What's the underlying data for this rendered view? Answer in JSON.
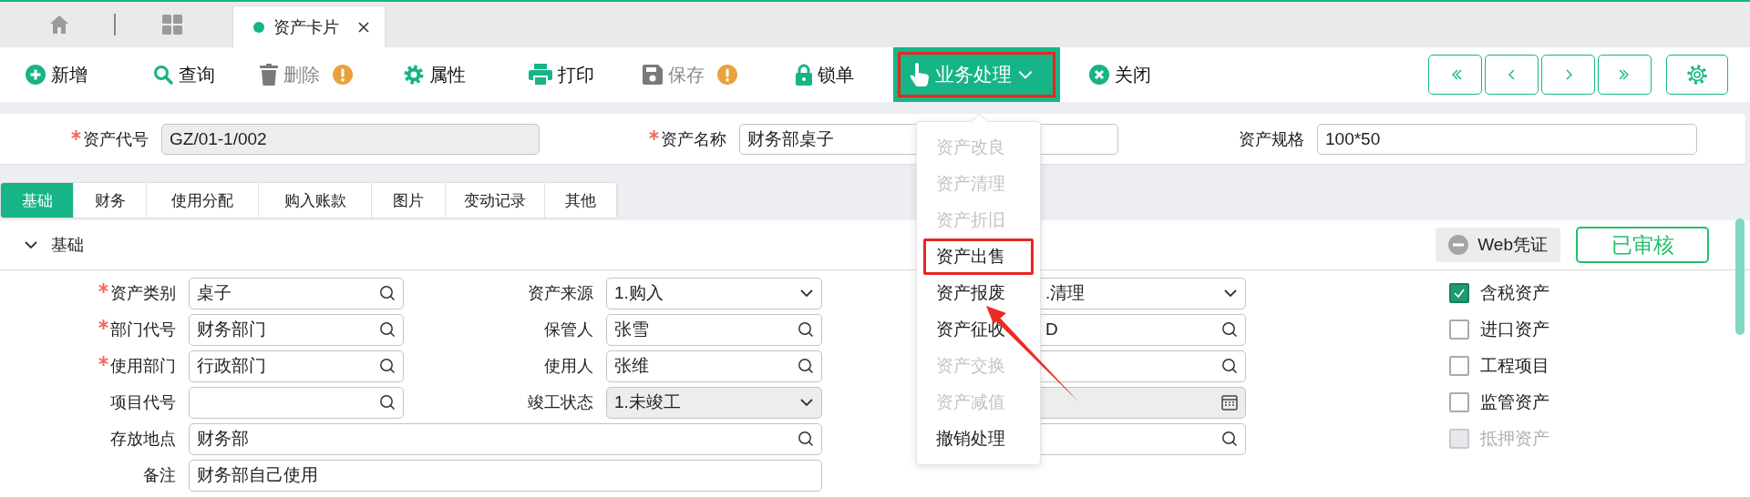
{
  "top_tabs": [
    {
      "label": "资产卡片",
      "selected": true
    }
  ],
  "toolbar": {
    "buttons": [
      {
        "label": "新增",
        "kind": "plain",
        "disabled": false,
        "warning": false
      },
      {
        "label": "查询",
        "kind": "plain",
        "disabled": false,
        "warning": false
      },
      {
        "label": "删除",
        "kind": "plain",
        "disabled": true,
        "warning": true
      },
      {
        "label": "属性",
        "kind": "plain",
        "disabled": false,
        "warning": false
      },
      {
        "label": "打印",
        "kind": "plain",
        "disabled": false,
        "warning": false
      },
      {
        "label": "保存",
        "kind": "plain",
        "disabled": true,
        "warning": true
      },
      {
        "label": "锁单",
        "kind": "plain",
        "disabled": false,
        "warning": false
      },
      {
        "label": "业务处理",
        "kind": "menu",
        "highlighted": true,
        "expanded": true
      },
      {
        "label": "关闭",
        "kind": "plain",
        "disabled": false,
        "warning": false
      }
    ]
  },
  "header_fields": [
    {
      "label": "资产代号",
      "required": true,
      "value": "GZ/01-1/002",
      "readonly": true
    },
    {
      "label": "资产名称",
      "required": true,
      "value": "财务部桌子",
      "readonly": false
    },
    {
      "label": "资产规格",
      "required": false,
      "value": "100*50",
      "readonly": false
    }
  ],
  "tabs": [
    {
      "label": "基础",
      "selected": true
    },
    {
      "label": "财务",
      "selected": false
    },
    {
      "label": "使用分配",
      "selected": false
    },
    {
      "label": "购入账款",
      "selected": false
    },
    {
      "label": "图片",
      "selected": false
    },
    {
      "label": "变动记录",
      "selected": false
    },
    {
      "label": "其他",
      "selected": false
    }
  ],
  "section": {
    "title": "基础",
    "expanded": true,
    "voucher_button": "Web凭证",
    "status_stamp": "已审核"
  },
  "form_rows": [
    {
      "left": {
        "label": "资产类别",
        "required": true,
        "kind": "search",
        "value": "桌子",
        "readonly": false
      },
      "middle": {
        "label": "资产来源",
        "required": false,
        "kind": "select",
        "value": "1.购入",
        "readonly": false
      },
      "right": {
        "kind": "select",
        "value": ".清理",
        "readonly": false
      }
    },
    {
      "left": {
        "label": "部门代号",
        "required": true,
        "kind": "search",
        "value": "财务部门",
        "readonly": false
      },
      "middle": {
        "label": "保管人",
        "required": false,
        "kind": "search",
        "value": "张雪",
        "readonly": false
      },
      "right": {
        "kind": "search",
        "value": "D",
        "readonly": false
      }
    },
    {
      "left": {
        "label": "使用部门",
        "required": true,
        "kind": "search",
        "value": "行政部门",
        "readonly": false
      },
      "middle": {
        "label": "使用人",
        "required": false,
        "kind": "search",
        "value": "张维",
        "readonly": false
      },
      "right": {
        "kind": "search",
        "readonly": false
      }
    },
    {
      "left": {
        "label": "项目代号",
        "required": false,
        "kind": "search",
        "readonly": false
      },
      "middle": {
        "label": "竣工状态",
        "required": false,
        "kind": "select",
        "value": "1.未竣工",
        "readonly": true
      },
      "right": {
        "kind": "date",
        "readonly": true
      }
    },
    {
      "left": {
        "label": "存放地点",
        "required": false,
        "kind": "search",
        "value": "财务部",
        "readonly": false
      },
      "right": {
        "kind": "search",
        "readonly": false
      }
    },
    {
      "left": {
        "label": "备注",
        "required": false,
        "kind": "text",
        "value": "财务部自己使用",
        "readonly": false
      }
    }
  ],
  "checkboxes": [
    {
      "label": "含税资产",
      "checked": true,
      "disabled": false
    },
    {
      "label": "进口资产",
      "checked": false,
      "disabled": false
    },
    {
      "label": "工程项目",
      "checked": false,
      "disabled": false
    },
    {
      "label": "监管资产",
      "checked": false,
      "disabled": false
    },
    {
      "label": "抵押资产",
      "checked": false,
      "disabled": true
    }
  ],
  "menu": {
    "items": [
      {
        "label": "资产改良",
        "disabled": true,
        "highlighted": false
      },
      {
        "label": "资产清理",
        "disabled": true,
        "highlighted": false
      },
      {
        "label": "资产折旧",
        "disabled": true,
        "highlighted": false
      },
      {
        "label": "资产出售",
        "disabled": false,
        "highlighted": true
      },
      {
        "label": "资产报废",
        "disabled": false,
        "highlighted": false
      },
      {
        "label": "资产征收",
        "disabled": false,
        "highlighted": false
      },
      {
        "label": "资产交换",
        "disabled": true,
        "highlighted": false
      },
      {
        "label": "资产减值",
        "disabled": true,
        "highlighted": false
      },
      {
        "label": "撤销处理",
        "disabled": false,
        "highlighted": false
      }
    ]
  },
  "annotations": [
    {
      "kind": "arrow"
    }
  ]
}
